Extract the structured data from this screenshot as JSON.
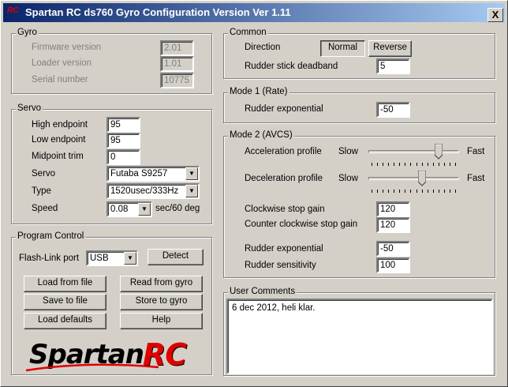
{
  "window": {
    "title": "Spartan RC ds760 Gyro Configuration Version Ver 1.11",
    "icon_text": "RC",
    "close_label": "X"
  },
  "gyro": {
    "label": "Gyro",
    "firmware_label": "Firmware version",
    "firmware_value": "2.01",
    "loader_label": "Loader version",
    "loader_value": "1.01",
    "serial_label": "Serial number",
    "serial_value": "10775"
  },
  "servo": {
    "label": "Servo",
    "high_label": "High endpoint",
    "high_value": "95",
    "low_label": "Low endpoint",
    "low_value": "95",
    "mid_label": "Midpoint trim",
    "mid_value": "0",
    "servo_label": "Servo",
    "servo_value": "Futaba S9257",
    "type_label": "Type",
    "type_value": "1520usec/333Hz",
    "speed_label": "Speed",
    "speed_value": "0.08",
    "speed_unit": "sec/60 deg"
  },
  "program": {
    "label": "Program Control",
    "flash_label": "Flash-Link port",
    "port_value": "USB",
    "detect": "Detect",
    "load_file": "Load from file",
    "read_gyro": "Read from gyro",
    "save_file": "Save to file",
    "store_gyro": "Store to gyro",
    "load_defaults": "Load defaults",
    "help": "Help",
    "logo_part1": "Spartan",
    "logo_part2": "RC"
  },
  "common": {
    "label": "Common",
    "direction_label": "Direction",
    "normal": "Normal",
    "reverse": "Reverse",
    "deadband_label": "Rudder stick deadband",
    "deadband_value": "5"
  },
  "mode1": {
    "label": "Mode 1 (Rate)",
    "rudder_exp_label": "Rudder exponential",
    "rudder_exp_value": "-50"
  },
  "mode2": {
    "label": "Mode 2 (AVCS)",
    "accel_label": "Acceleration profile",
    "decel_label": "Deceleration profile",
    "slow": "Slow",
    "fast": "Fast",
    "accel_level": 0.8,
    "decel_level": 0.6,
    "cw_label": "Clockwise stop gain",
    "cw_value": "120",
    "ccw_label": "Counter clockwise stop gain",
    "ccw_value": "120",
    "rudder_exp_label": "Rudder exponential",
    "rudder_exp_value": "-50",
    "sens_label": "Rudder sensitivity",
    "sens_value": "100"
  },
  "comments": {
    "label": "User Comments",
    "text": "6 dec 2012, heli klar."
  },
  "colors": {
    "title_start": "#0a246a",
    "title_end": "#a6caf0",
    "logo_red": "#e00000",
    "face": "#d4d0c8"
  }
}
